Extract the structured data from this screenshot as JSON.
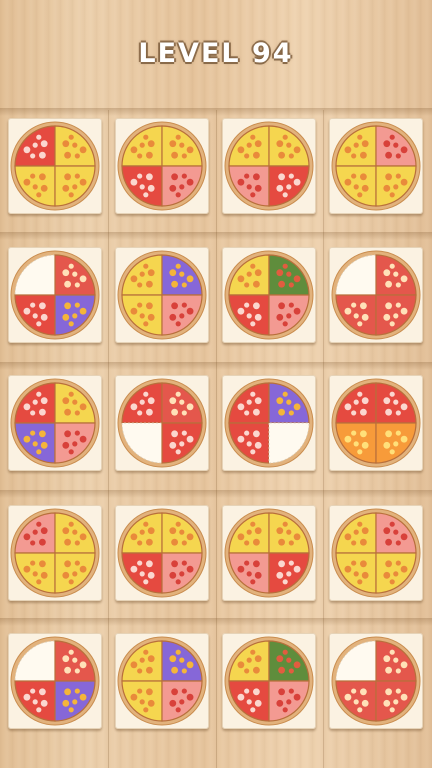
{
  "level_title": "LEVEL 94",
  "colors": {
    "cheese": "#f5d64f",
    "tomato": "#e4574c",
    "salami": "#e54a40",
    "pink": "#f39a92",
    "purple": "#8667d8",
    "green": "#5f8d3c",
    "orange": "#f79b3a",
    "crust": "#d9a46a",
    "empty": "#fffaf0"
  },
  "grid": [
    [
      "pink",
      "cheese",
      "cheese",
      "cheese"
    ],
    [
      "empty",
      "tomato",
      "empty",
      "tomato"
    ],
    [
      "tomato",
      "tomato",
      "tomato",
      "cheese"
    ],
    [
      "pink",
      "cheese",
      "cheese",
      "cheese"
    ],
    [
      "empty",
      "tomato",
      "green",
      "tomato"
    ]
  ],
  "pizzas": [
    [
      "salami",
      "cheese",
      "cheese",
      "cheese"
    ],
    [
      "cheese",
      "cheese",
      "salami",
      "pink"
    ],
    [
      "cheese",
      "cheese",
      "pink",
      "salami"
    ],
    [
      "cheese",
      "pink",
      "cheese",
      "cheese"
    ],
    [
      "empty",
      "tomato",
      "salami",
      "purple"
    ],
    [
      "cheese",
      "purple",
      "cheese",
      "pink"
    ],
    [
      "cheese",
      "green",
      "salami",
      "pink"
    ],
    [
      "empty",
      "tomato",
      "tomato",
      "tomato"
    ],
    [
      "salami",
      "cheese",
      "purple",
      "pink"
    ],
    [
      "salami",
      "tomato",
      "empty",
      "salami"
    ],
    [
      "salami",
      "purple",
      "salami",
      "empty"
    ],
    [
      "salami",
      "salami",
      "orange",
      "orange"
    ],
    [
      "pink",
      "cheese",
      "cheese",
      "cheese"
    ],
    [
      "cheese",
      "cheese",
      "salami",
      "pink"
    ],
    [
      "cheese",
      "cheese",
      "pink",
      "salami"
    ],
    [
      "cheese",
      "pink",
      "cheese",
      "cheese"
    ],
    [
      "empty",
      "tomato",
      "salami",
      "purple"
    ],
    [
      "cheese",
      "purple",
      "cheese",
      "pink"
    ],
    [
      "cheese",
      "green",
      "salami",
      "pink"
    ],
    [
      "empty",
      "tomato",
      "tomato",
      "tomato"
    ]
  ]
}
